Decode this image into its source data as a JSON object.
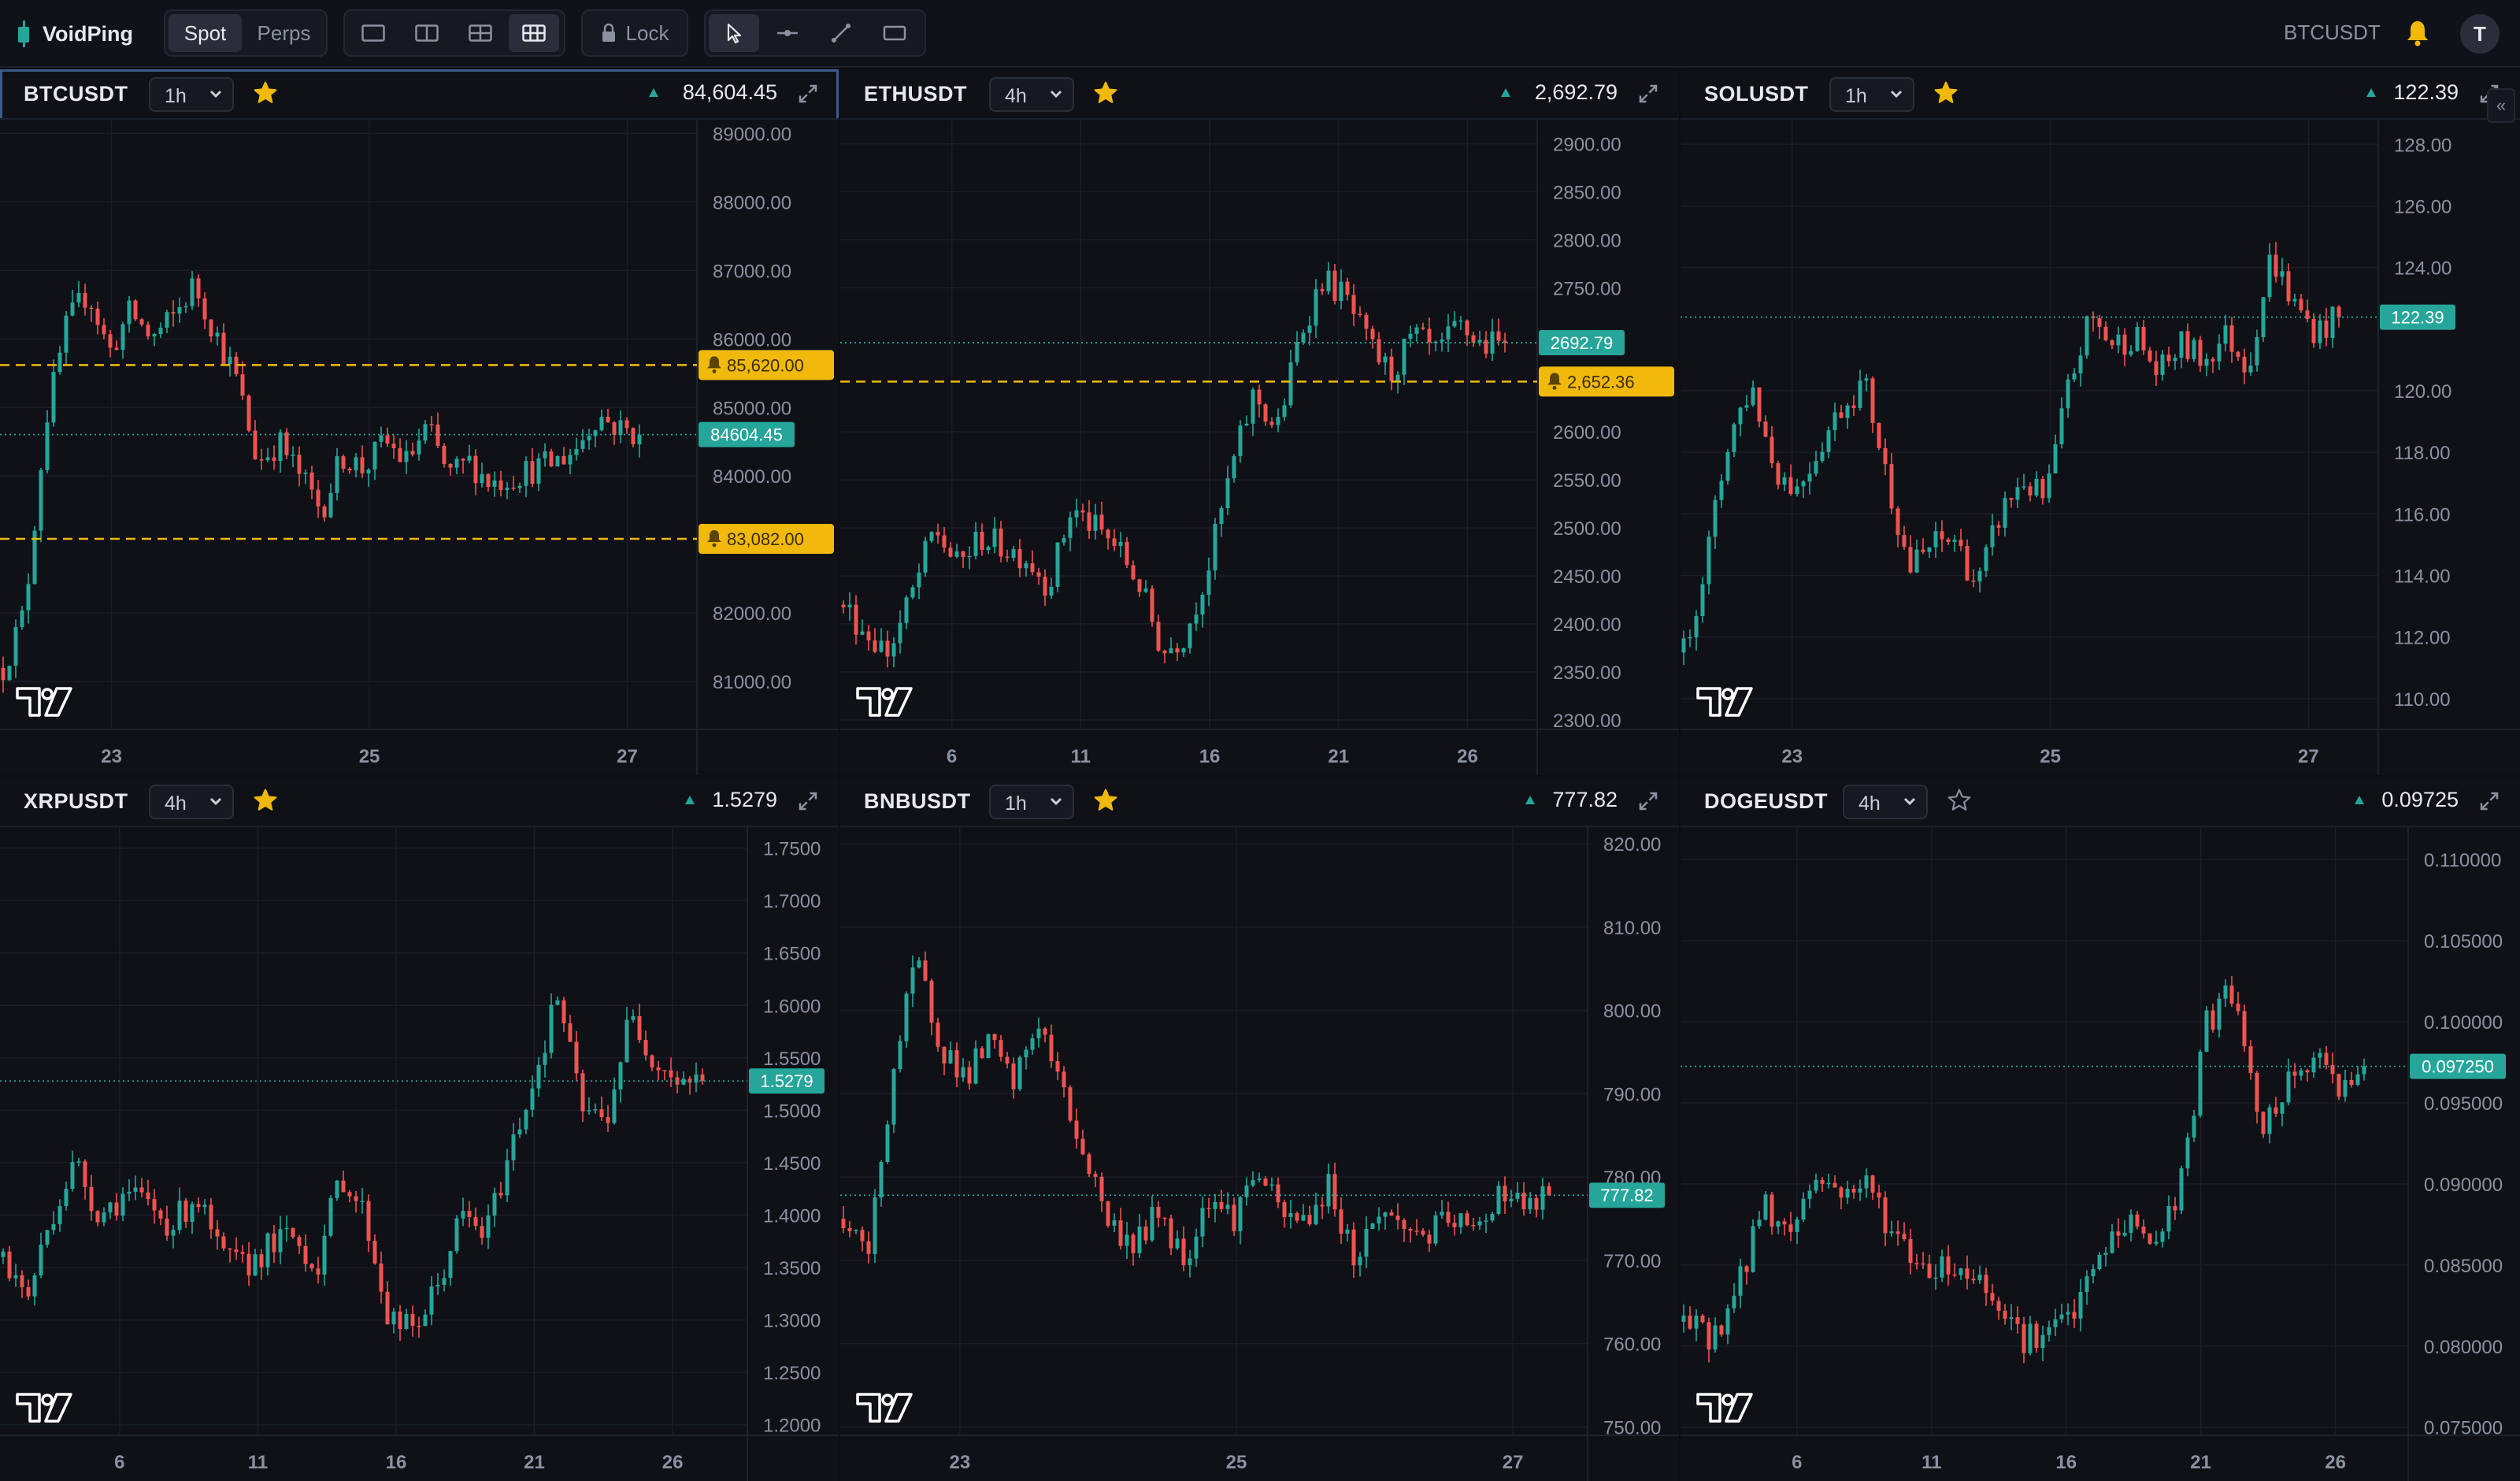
{
  "app": {
    "name": "VoidPing",
    "market_tabs": [
      "Spot",
      "Perps"
    ],
    "active_market": "Spot",
    "layout_buttons": [
      "layout-1-icon",
      "layout-2-icon",
      "layout-4-icon",
      "layout-6-icon"
    ],
    "active_layout": "layout-6-icon",
    "lock_label": "Lock",
    "tools": [
      "cursor-icon",
      "horizontal-line-icon",
      "trendline-icon",
      "rectangle-icon"
    ],
    "active_tool": "cursor-icon",
    "header_symbol": "BTCUSDT",
    "avatar_initial": "T",
    "collapse_label": "«"
  },
  "colors": {
    "up": "#26a69a",
    "down": "#ef5350",
    "alert": "#f0b90b",
    "background": "#0f1117"
  },
  "panels": [
    {
      "symbol": "BTCUSDT",
      "timeframe": "1h",
      "starred": true,
      "price": "84,604.45",
      "price_tag": "84604.45",
      "alerts": [
        {
          "label": "85,620.00",
          "value": 85620
        },
        {
          "label": "83,082.00",
          "value": 83082
        }
      ],
      "chart_data": {
        "type": "candlestick",
        "yticks": [
          "89000.00",
          "88000.00",
          "87000.00",
          "86000.00",
          "85000.00",
          "84000.00",
          "82000.00",
          "81000.00"
        ],
        "ytick_values": [
          89000,
          88000,
          87000,
          86000,
          85000,
          84000,
          82000,
          81000
        ],
        "ylim": [
          80300,
          89200
        ],
        "xticks": [
          "23",
          "25",
          "27"
        ],
        "last": 84604.45,
        "path": [
          81200,
          82000,
          84800,
          86200,
          86700,
          85800,
          86400,
          86000,
          86300,
          86800,
          86100,
          85400,
          84200,
          84500,
          84000,
          83500,
          84300,
          84100,
          84500,
          84200,
          84700,
          84000,
          84200,
          83900,
          84000,
          84100,
          84200,
          84400,
          84900,
          84700,
          84604
        ]
      }
    },
    {
      "symbol": "ETHUSDT",
      "timeframe": "4h",
      "starred": true,
      "price": "2,692.79",
      "price_tag": "2692.79",
      "alerts": [
        {
          "label": "2,652.36",
          "value": 2652.36
        }
      ],
      "chart_data": {
        "type": "candlestick",
        "yticks": [
          "2900.00",
          "2850.00",
          "2800.00",
          "2750.00",
          "2600.00",
          "2550.00",
          "2500.00",
          "2450.00",
          "2400.00",
          "2350.00",
          "2300.00"
        ],
        "ytick_values": [
          2900,
          2850,
          2800,
          2750,
          2600,
          2550,
          2500,
          2450,
          2400,
          2350,
          2300
        ],
        "ylim": [
          2290,
          2925
        ],
        "xticks": [
          "6",
          "11",
          "16",
          "21",
          "26"
        ],
        "last": 2692.79,
        "path": [
          2420,
          2390,
          2370,
          2430,
          2500,
          2460,
          2490,
          2480,
          2470,
          2440,
          2520,
          2500,
          2480,
          2440,
          2370,
          2390,
          2460,
          2560,
          2640,
          2600,
          2700,
          2760,
          2740,
          2690,
          2660,
          2700,
          2680,
          2710,
          2690,
          2692
        ]
      }
    },
    {
      "symbol": "SOLUSDT",
      "timeframe": "1h",
      "starred": true,
      "price": "122.39",
      "price_tag": "122.39",
      "alerts": [],
      "chart_data": {
        "type": "candlestick",
        "yticks": [
          "128.00",
          "126.00",
          "124.00",
          "120.00",
          "118.00",
          "116.00",
          "114.00",
          "112.00",
          "110.00"
        ],
        "ytick_values": [
          128,
          126,
          124,
          120,
          118,
          116,
          114,
          112,
          110
        ],
        "ylim": [
          109,
          128.8
        ],
        "xticks": [
          "23",
          "25",
          "27"
        ],
        "last": 122.39,
        "path": [
          111.5,
          114.5,
          118.5,
          120.2,
          117.5,
          116.8,
          118.2,
          119.5,
          120.3,
          117.2,
          114.2,
          115.0,
          115.2,
          113.6,
          116.0,
          117.1,
          116.4,
          120.0,
          122.4,
          121.5,
          121.8,
          120.5,
          121.5,
          121.0,
          121.8,
          120.8,
          124.4,
          122.8,
          121.9,
          122.4
        ]
      }
    },
    {
      "symbol": "XRPUSDT",
      "timeframe": "4h",
      "starred": true,
      "price": "1.5279",
      "price_tag": "1.5279",
      "alerts": [],
      "chart_data": {
        "type": "candlestick",
        "yticks": [
          "1.7500",
          "1.7000",
          "1.6500",
          "1.6000",
          "1.5500",
          "1.5000",
          "1.4500",
          "1.4000",
          "1.3500",
          "1.3000",
          "1.2500",
          "1.2000"
        ],
        "ytick_values": [
          1.75,
          1.7,
          1.65,
          1.6,
          1.55,
          1.5,
          1.45,
          1.4,
          1.35,
          1.3,
          1.25,
          1.2
        ],
        "ylim": [
          1.19,
          1.77
        ],
        "xticks": [
          "6",
          "11",
          "16",
          "21",
          "26"
        ],
        "last": 1.5279,
        "path": [
          1.36,
          1.32,
          1.4,
          1.45,
          1.4,
          1.42,
          1.41,
          1.39,
          1.42,
          1.36,
          1.35,
          1.37,
          1.38,
          1.35,
          1.44,
          1.4,
          1.3,
          1.29,
          1.33,
          1.4,
          1.38,
          1.46,
          1.53,
          1.61,
          1.5,
          1.49,
          1.59,
          1.55,
          1.53,
          1.528
        ]
      }
    },
    {
      "symbol": "BNBUSDT",
      "timeframe": "1h",
      "starred": true,
      "price": "777.82",
      "price_tag": "777.82",
      "alerts": [],
      "chart_data": {
        "type": "candlestick",
        "yticks": [
          "820.00",
          "810.00",
          "800.00",
          "790.00",
          "780.00",
          "770.00",
          "760.00",
          "750.00"
        ],
        "ytick_values": [
          820,
          810,
          800,
          790,
          780,
          770,
          760,
          750
        ],
        "ylim": [
          749,
          822
        ],
        "xticks": [
          "23",
          "25",
          "27"
        ],
        "last": 777.82,
        "path": [
          775,
          770,
          792,
          806,
          796,
          792,
          796,
          791,
          799,
          790,
          782,
          774,
          772,
          776,
          770,
          778,
          775,
          781,
          775,
          775,
          779,
          770,
          776,
          774,
          773,
          775,
          773,
          779,
          776,
          777.8
        ]
      }
    },
    {
      "symbol": "DOGEUSDT",
      "timeframe": "4h",
      "starred": false,
      "price": "0.09725",
      "price_tag": "0.097250",
      "alerts": [],
      "chart_data": {
        "type": "candlestick",
        "yticks": [
          "0.110000",
          "0.105000",
          "0.100000",
          "0.095000",
          "0.090000",
          "0.085000",
          "0.080000",
          "0.075000"
        ],
        "ytick_values": [
          0.11,
          0.105,
          0.1,
          0.095,
          0.09,
          0.085,
          0.08,
          0.075
        ],
        "ylim": [
          0.0745,
          0.112
        ],
        "xticks": [
          "6",
          "11",
          "16",
          "21",
          "26"
        ],
        "last": 0.09725,
        "path": [
          0.0815,
          0.0805,
          0.083,
          0.089,
          0.0868,
          0.0905,
          0.0895,
          0.09,
          0.087,
          0.085,
          0.085,
          0.0845,
          0.083,
          0.0805,
          0.0808,
          0.0822,
          0.0858,
          0.0878,
          0.0862,
          0.09,
          0.1,
          0.102,
          0.093,
          0.0958,
          0.0978,
          0.0962,
          0.0972
        ]
      }
    }
  ]
}
